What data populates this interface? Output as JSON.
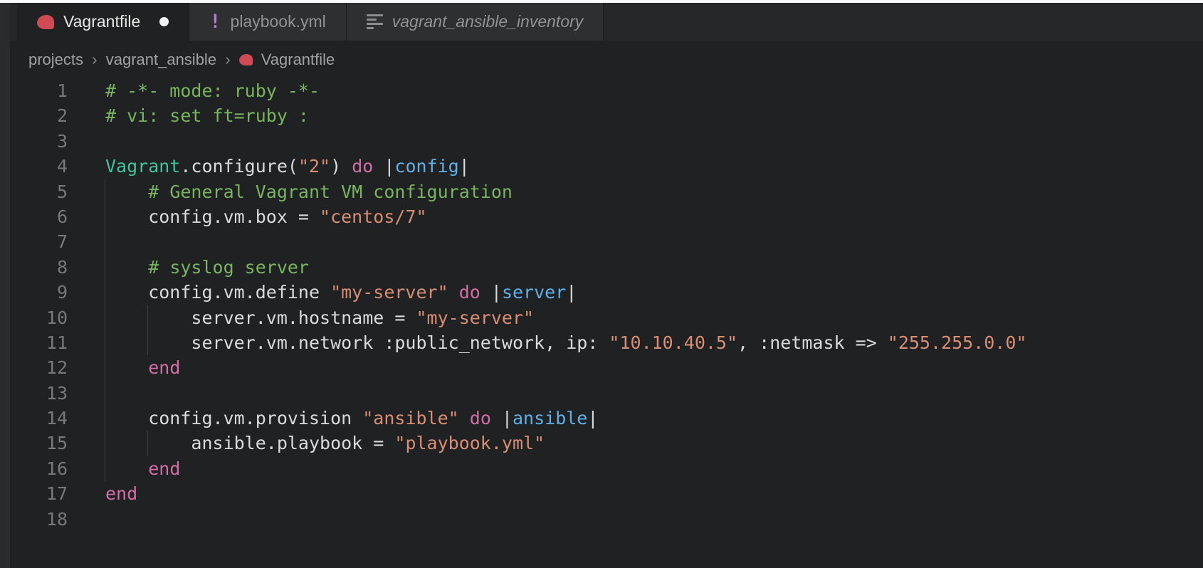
{
  "tabs": [
    {
      "label": "Vagrantfile",
      "icon": "ruby-icon",
      "state": "active",
      "modified": true
    },
    {
      "label": "playbook.yml",
      "icon": "yaml-icon",
      "icon_glyph": "!",
      "state": "inactive",
      "modified": false
    },
    {
      "label": "vagrant_ansible_inventory",
      "icon": "document-icon",
      "state": "inactive-preview",
      "modified": false
    }
  ],
  "breadcrumb": {
    "items": [
      "projects",
      "vagrant_ansible",
      "Vagrantfile"
    ],
    "separator": "›"
  },
  "editor": {
    "language": "ruby",
    "lines": [
      {
        "num": "1",
        "guides": [],
        "tokens": [
          [
            "com",
            "# -*- mode: ruby -*-"
          ]
        ]
      },
      {
        "num": "2",
        "guides": [],
        "tokens": [
          [
            "com",
            "# vi: set ft=ruby :"
          ]
        ]
      },
      {
        "num": "3",
        "guides": [],
        "tokens": []
      },
      {
        "num": "4",
        "guides": [],
        "tokens": [
          [
            "cls",
            "Vagrant"
          ],
          [
            "pln",
            ".configure("
          ],
          [
            "str",
            "\"2\""
          ],
          [
            "pln",
            ") "
          ],
          [
            "kw",
            "do"
          ],
          [
            "pln",
            " |"
          ],
          [
            "prm",
            "config"
          ],
          [
            "pln",
            "|"
          ]
        ]
      },
      {
        "num": "5",
        "guides": [
          0
        ],
        "tokens": [
          [
            "pln",
            "    "
          ],
          [
            "com",
            "# General Vagrant VM configuration"
          ]
        ]
      },
      {
        "num": "6",
        "guides": [
          0
        ],
        "tokens": [
          [
            "pln",
            "    config.vm.box = "
          ],
          [
            "str",
            "\"centos/7\""
          ]
        ]
      },
      {
        "num": "7",
        "guides": [
          0
        ],
        "tokens": []
      },
      {
        "num": "8",
        "guides": [
          0
        ],
        "tokens": [
          [
            "pln",
            "    "
          ],
          [
            "com",
            "# syslog server"
          ]
        ]
      },
      {
        "num": "9",
        "guides": [
          0
        ],
        "tokens": [
          [
            "pln",
            "    config.vm.define "
          ],
          [
            "str",
            "\"my-server\""
          ],
          [
            "pln",
            " "
          ],
          [
            "kw",
            "do"
          ],
          [
            "pln",
            " |"
          ],
          [
            "prm",
            "server"
          ],
          [
            "pln",
            "|"
          ]
        ]
      },
      {
        "num": "10",
        "guides": [
          0,
          1
        ],
        "tokens": [
          [
            "pln",
            "        server.vm.hostname = "
          ],
          [
            "str",
            "\"my-server\""
          ]
        ]
      },
      {
        "num": "11",
        "guides": [
          0,
          1
        ],
        "tokens": [
          [
            "pln",
            "        server.vm.network :public_network, ip: "
          ],
          [
            "str",
            "\"10.10.40.5\""
          ],
          [
            "pln",
            ", :netmask => "
          ],
          [
            "str",
            "\"255.255.0.0\""
          ]
        ]
      },
      {
        "num": "12",
        "guides": [
          0
        ],
        "tokens": [
          [
            "pln",
            "    "
          ],
          [
            "kw",
            "end"
          ]
        ]
      },
      {
        "num": "13",
        "guides": [
          0
        ],
        "tokens": []
      },
      {
        "num": "14",
        "guides": [
          0
        ],
        "tokens": [
          [
            "pln",
            "    config.vm.provision "
          ],
          [
            "str",
            "\"ansible\""
          ],
          [
            "pln",
            " "
          ],
          [
            "kw",
            "do"
          ],
          [
            "pln",
            " |"
          ],
          [
            "prm",
            "ansible"
          ],
          [
            "pln",
            "|"
          ]
        ]
      },
      {
        "num": "15",
        "guides": [
          0,
          1
        ],
        "tokens": [
          [
            "pln",
            "        ansible.playbook = "
          ],
          [
            "str",
            "\"playbook.yml\""
          ]
        ]
      },
      {
        "num": "16",
        "guides": [
          0
        ],
        "tokens": [
          [
            "pln",
            "    "
          ],
          [
            "kw",
            "end"
          ]
        ]
      },
      {
        "num": "17",
        "guides": [],
        "tokens": [
          [
            "kw",
            "end"
          ]
        ]
      },
      {
        "num": "18",
        "guides": [],
        "tokens": []
      }
    ]
  },
  "colors": {
    "editor_bg": "#1f2123",
    "tabbar_bg": "#252728",
    "tab_inactive_bg": "#2d2f30",
    "tab_active_text": "#e8e8e6",
    "tab_inactive_text": "#909395",
    "top_strip": "#fafafa",
    "left_strip": "#292b2c",
    "breadcrumb_text": "#9fa2a4",
    "ruby_icon": "#cf4a54",
    "yaml_icon": "#bb77d0",
    "comment": "#79b45e",
    "string": "#d98e73",
    "keyword": "#d36da4",
    "class_name": "#42c3a0",
    "param": "#5fb0e8",
    "code_text": "#d8dadc",
    "line_number": "#75797c",
    "indent_guide": "#3a3d3f"
  }
}
